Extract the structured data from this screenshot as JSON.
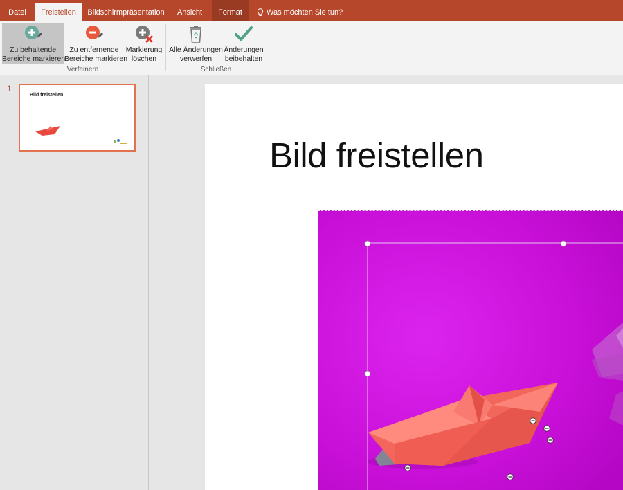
{
  "tabs": {
    "datei": "Datei",
    "freistellen": "Freistellen",
    "bildschirm": "Bildschirmpräsentation",
    "ansicht": "Ansicht",
    "format": "Format",
    "tellme": "Was möchten Sie tun?"
  },
  "ribbon": {
    "add_line1": "Zu behaltende",
    "add_line2": "Bereiche markieren",
    "remove_line1": "Zu entfernende",
    "remove_line2": "Bereiche markieren",
    "delete_line1": "Markierung",
    "delete_line2": "löschen",
    "discard_line1": "Alle Änderungen",
    "discard_line2": "verwerfen",
    "keep_line1": "Änderungen",
    "keep_line2": "beibehalten",
    "group_refine": "Verfeinern",
    "group_close": "Schließen"
  },
  "thumbnails": {
    "slide_number": "1",
    "slide_title": "Bild freistellen"
  },
  "slide": {
    "title": "Bild freistellen"
  },
  "colors": {
    "accent": "#b7472a",
    "photo_background": "#cc12db",
    "boat": "#f4675f"
  },
  "icons": {
    "add": "plus-circle-pencil-icon",
    "remove": "minus-circle-pencil-icon",
    "delete": "plus-circle-x-icon",
    "discard": "recycle-bin-icon",
    "keep": "checkmark-icon"
  }
}
